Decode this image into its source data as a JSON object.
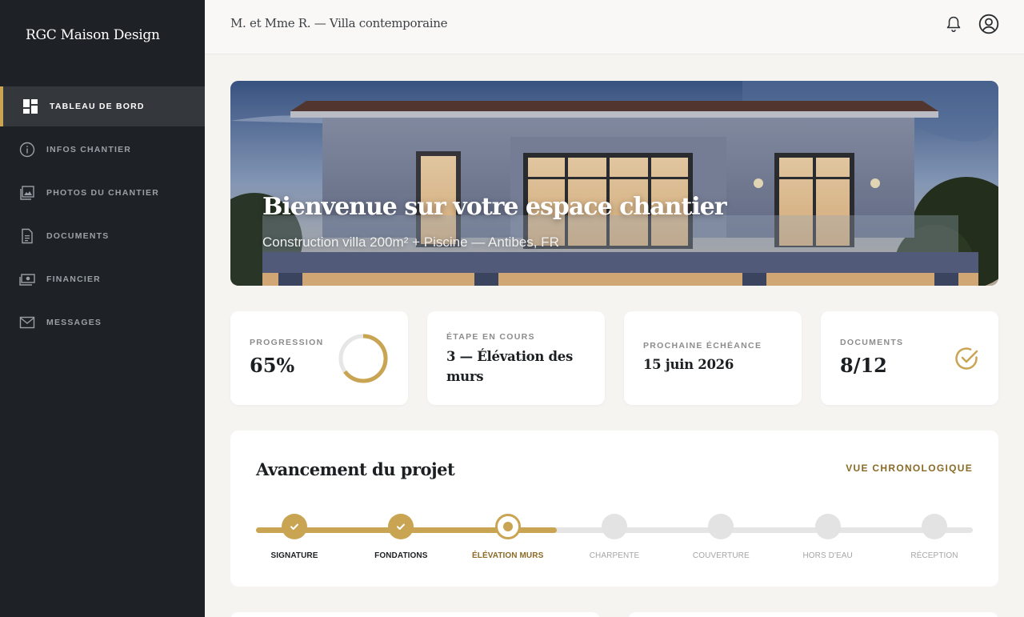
{
  "app": {
    "brand": "RGC Maison Design"
  },
  "sidebar": {
    "items": [
      {
        "label": "TABLEAU DE BORD",
        "icon": "dashboard-icon",
        "active": true
      },
      {
        "label": "INFOS CHANTIER",
        "icon": "info-icon"
      },
      {
        "label": "PHOTOS DU CHANTIER",
        "icon": "photos-icon"
      },
      {
        "label": "DOCUMENTS",
        "icon": "document-icon"
      },
      {
        "label": "FINANCIER",
        "icon": "money-icon"
      },
      {
        "label": "MESSAGES",
        "icon": "mail-icon"
      }
    ]
  },
  "header": {
    "client": "M. et Mme R. — Villa contemporaine",
    "icons": [
      "bell-icon",
      "user-icon"
    ]
  },
  "hero": {
    "title": "Bienvenue sur votre espace chantier",
    "subtitle": "Construction villa 200m² + Piscine — Antibes, FR"
  },
  "stats": {
    "progress": {
      "label": "PROGRESSION",
      "value": "65%",
      "fraction": 0.65
    },
    "stage": {
      "label": "ÉTAPE EN COURS",
      "value": "3 — Élévation des murs"
    },
    "deadline": {
      "label": "PROCHAINE ÉCHÉANCE",
      "value": "15 juin 2026"
    },
    "documents": {
      "label": "DOCUMENTS",
      "value": "8/12"
    }
  },
  "timeline": {
    "title": "Avancement du projet",
    "link": "VUE CHRONOLOGIQUE",
    "progress_fraction": 0.42,
    "steps": [
      {
        "label": "SIGNATURE",
        "status": "done"
      },
      {
        "label": "FONDATIONS",
        "status": "done"
      },
      {
        "label": "ÉLÉVATION MURS",
        "status": "current"
      },
      {
        "label": "CHARPENTE",
        "status": "pending"
      },
      {
        "label": "COUVERTURE",
        "status": "pending"
      },
      {
        "label": "HORS D'EAU",
        "status": "pending"
      },
      {
        "label": "RÉCEPTION",
        "status": "pending"
      }
    ]
  },
  "colors": {
    "accent": "#c9a452",
    "sidebar": "#1e2226",
    "background": "#f5f4f1"
  }
}
